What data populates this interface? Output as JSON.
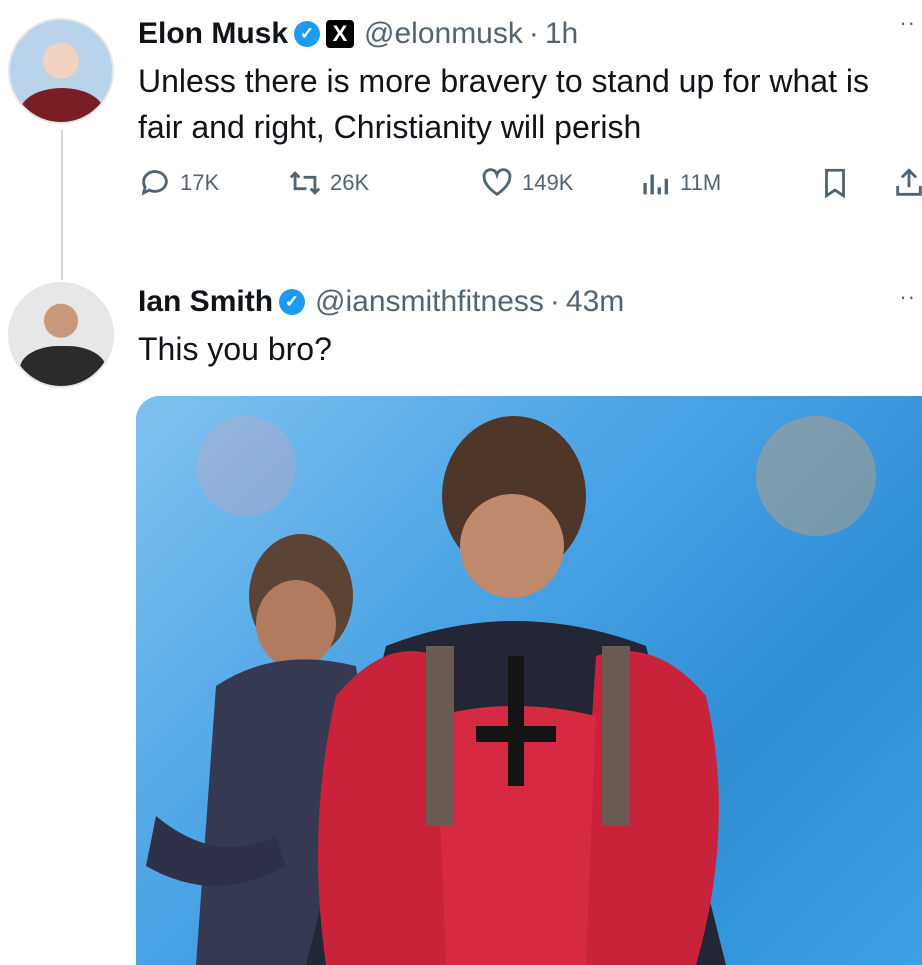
{
  "tweet1": {
    "name": "Elon Musk",
    "handle": "@elonmusk",
    "separator": "·",
    "time": "1h",
    "text": "Unless there is more bravery to stand up for what is fair and right, Christianity will perish",
    "stats": {
      "replies": "17K",
      "reposts": "26K",
      "likes": "149K",
      "views": "11M"
    }
  },
  "tweet2": {
    "name": "Ian Smith",
    "handle": "@iansmithfitness",
    "separator": "·",
    "time": "43m",
    "text": "This you bro?"
  },
  "colors": {
    "verified": "#1d9bf0",
    "secondary_text": "#536471"
  },
  "icons": [
    "reply-icon",
    "repost-icon",
    "like-icon",
    "views-icon",
    "bookmark-icon",
    "share-icon",
    "verified-badge-icon",
    "x-logo-icon",
    "more-icon"
  ]
}
